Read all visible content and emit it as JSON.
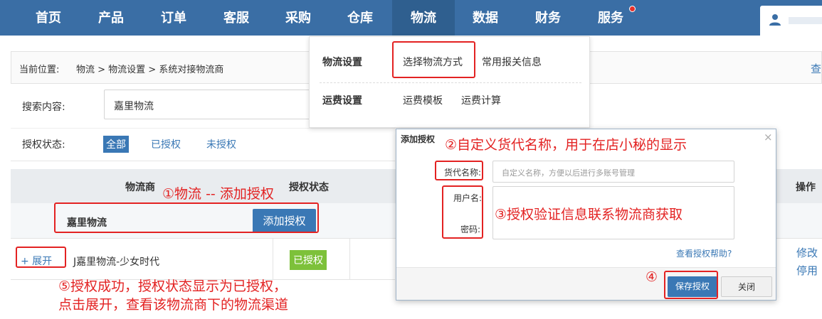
{
  "nav": {
    "items": [
      "首页",
      "产品",
      "订单",
      "客服",
      "采购",
      "仓库",
      "物流",
      "数据",
      "财务",
      "服务"
    ]
  },
  "dropdown": {
    "group1_title": "物流设置",
    "group1_links": [
      "选择物流方式",
      "常用报关信息"
    ],
    "group2_title": "运费设置",
    "group2_links": [
      "运费模板",
      "运费计算"
    ]
  },
  "breadcrumb": {
    "prefix": "当前位置:",
    "path": "物流 > 物流设置 > 系统对接物流商",
    "right_link": "查"
  },
  "search": {
    "label": "搜索内容:",
    "value": "嘉里物流"
  },
  "auth_filter": {
    "label": "授权状态:",
    "options": [
      "全部",
      "已授权",
      "未授权"
    ]
  },
  "table": {
    "col_provider": "物流商",
    "col_status": "授权状态",
    "col_actions": "操作",
    "group_name": "嘉里物流",
    "add_auth_button": "添加授权",
    "expand_link": "+ 展开",
    "row_name": "J嘉里物流-少女时代",
    "row_status": "已授权",
    "action_edit": "修改",
    "action_disable": "停用"
  },
  "modal": {
    "title": "添加授权",
    "close": "×",
    "label_alias": "货代名称:",
    "alias_placeholder": "自定义名称，方便以后进行多账号管理",
    "label_username": "用户名:",
    "label_password": "密码:",
    "help_link": "查看授权帮助?",
    "save_button": "保存授权",
    "close_button": "关闭"
  },
  "annotations": {
    "a1": "①物流 -- 添加授权",
    "a2": "②自定义货代名称，用于在店小秘的显示",
    "a3": "③授权验证信息联系物流商获取",
    "a4": "④",
    "a5_line1": "⑤授权成功，授权状态显示为已授权，",
    "a5_line2": "点击展开，查看该物流商下的物流渠道"
  },
  "colors": {
    "nav_bg": "#3a6ea5",
    "accent": "#3a78b5",
    "annotation": "#e32222",
    "authorized_badge": "#7dc13a"
  }
}
